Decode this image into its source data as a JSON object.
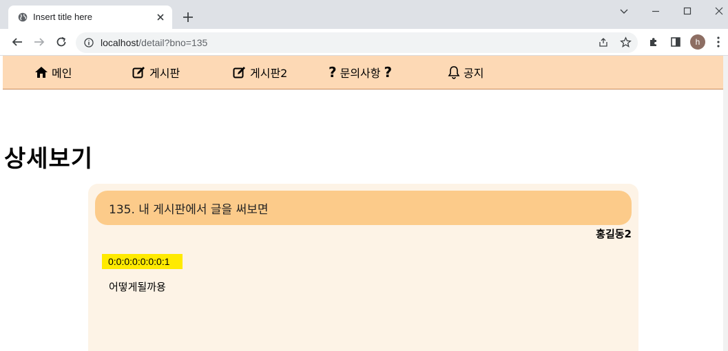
{
  "browser": {
    "tab_title": "Insert title here",
    "url_host": "localhost",
    "url_path": "/detail?bno=135",
    "profile_initial": "h"
  },
  "nav": {
    "items": [
      {
        "label": "메인",
        "icon": "home-icon"
      },
      {
        "label": "게시판",
        "icon": "edit-icon"
      },
      {
        "label": "게시판2",
        "icon": "edit-icon"
      },
      {
        "label": "문의사항",
        "icon": "question-icon"
      },
      {
        "label": "공지",
        "icon": "bell-icon"
      }
    ],
    "question_mark": "?"
  },
  "page": {
    "heading": "상세보기"
  },
  "post": {
    "title": "135. 내 게시판에서 글을 써보면",
    "author": "홍길동2",
    "ip": "0:0:0:0:0:0:0:1",
    "content": "어떻게될까용"
  },
  "colors": {
    "nav_bg": "#fdd9b5",
    "card_bg": "#fdf3e6",
    "title_bar_bg": "#fccb8a",
    "ip_highlight": "#ffea00"
  }
}
